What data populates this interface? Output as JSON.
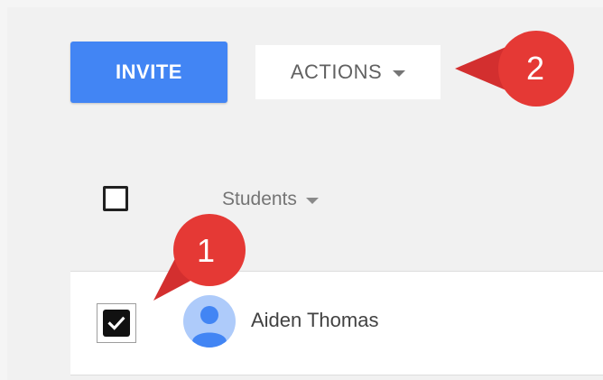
{
  "toolbar": {
    "invite_label": "INVITE",
    "actions_label": "ACTIONS"
  },
  "table": {
    "column_header": "Students",
    "rows": [
      {
        "name": "Aiden Thomas",
        "checked": true
      }
    ]
  },
  "callouts": [
    {
      "number": "1"
    },
    {
      "number": "2"
    }
  ],
  "colors": {
    "primary": "#4285f4",
    "callout": "#e53935",
    "avatar_bg": "#aecbfa",
    "avatar_fg": "#4285f4"
  }
}
